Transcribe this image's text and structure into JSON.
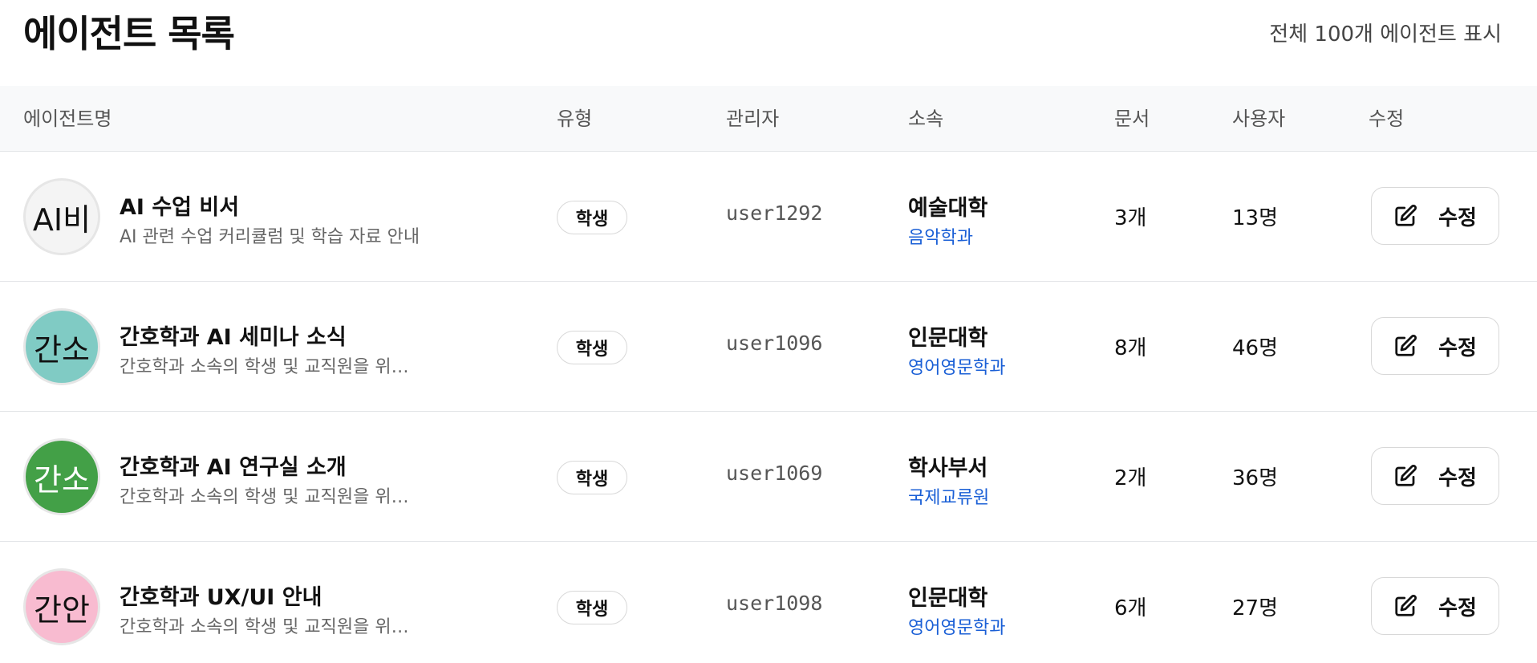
{
  "header": {
    "title": "에이전트 목록",
    "total_count": "전체 100개 에이전트 표시"
  },
  "table": {
    "columns": [
      "에이전트명",
      "유형",
      "관리자",
      "소속",
      "문서",
      "사용자",
      "수정"
    ],
    "rows": [
      {
        "avatar_text": "AI비",
        "avatar_color": "#f4f4f4",
        "avatar_text_color": "#111111",
        "name": "AI 수업 비서",
        "description": "AI 관련 수업 커리큘럼 및 학습 자료 안내",
        "type": "학생",
        "manager": "user1292",
        "org_primary": "예술대학",
        "org_secondary": "음악학과",
        "documents": "3개",
        "users": "13명",
        "edit_label": "수정"
      },
      {
        "avatar_text": "간소",
        "avatar_color": "#80cbc4",
        "avatar_text_color": "#111111",
        "name": "간호학과 AI 세미나 소식",
        "description": "간호학과 소속의 학생 및 교직원을 위한 안내",
        "type": "학생",
        "manager": "user1096",
        "org_primary": "인문대학",
        "org_secondary": "영어영문학과",
        "documents": "8개",
        "users": "46명",
        "edit_label": "수정"
      },
      {
        "avatar_text": "간소",
        "avatar_color": "#43a047",
        "avatar_text_color": "#ffffff",
        "name": "간호학과 AI 연구실 소개",
        "description": "간호학과 소속의 학생 및 교직원을 위한 안내",
        "type": "학생",
        "manager": "user1069",
        "org_primary": "학사부서",
        "org_secondary": "국제교류원",
        "documents": "2개",
        "users": "36명",
        "edit_label": "수정"
      },
      {
        "avatar_text": "간안",
        "avatar_color": "#f8bbd0",
        "avatar_text_color": "#111111",
        "name": "간호학과 UX/UI 안내",
        "description": "간호학과 소속의 학생 및 교직원을 위한 안내",
        "type": "학생",
        "manager": "user1098",
        "org_primary": "인문대학",
        "org_secondary": "영어영문학과",
        "documents": "6개",
        "users": "27명",
        "edit_label": "수정"
      }
    ]
  },
  "icons": {
    "edit": "edit-icon"
  },
  "colors": {
    "link_blue": "#1a5fd6",
    "header_bg": "#f8f9fa",
    "border": "#e3e5e8"
  }
}
